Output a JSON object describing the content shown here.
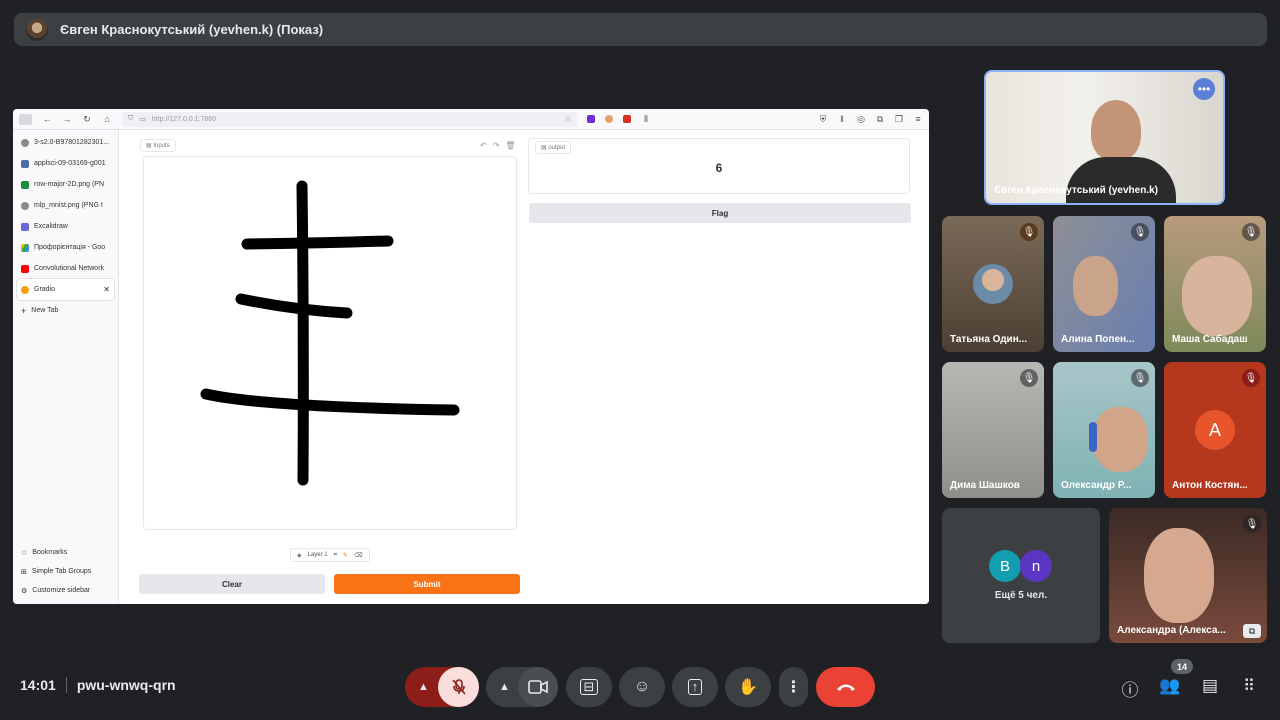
{
  "meeting": {
    "presenter_title": "Євген Краснокутський (yevhen.k) (Показ)",
    "time": "14:01",
    "code": "pwu-wnwq-qrn",
    "participants_count": "14"
  },
  "browser": {
    "url": "http://127.0.0.1:7860",
    "tabs": [
      {
        "label": "3-s2.0-B97801282301...",
        "icon": "globe-icon"
      },
      {
        "label": "applsci-09-03169-g001",
        "icon": "image-icon"
      },
      {
        "label": "row-major-2D.png (PN",
        "icon": "image-icon"
      },
      {
        "label": "mlp_mnist.png (PNG I",
        "icon": "globe-icon"
      },
      {
        "label": "Excalidraw",
        "icon": "excalidraw-icon"
      },
      {
        "label": "Профорієнтація - Goo",
        "icon": "drive-icon"
      },
      {
        "label": "Convolutional Network",
        "icon": "youtube-icon"
      },
      {
        "label": "Gradio",
        "icon": "gradio-icon",
        "active": true
      },
      {
        "label": "New Tab",
        "icon": "plus-icon"
      }
    ],
    "bottom_items": [
      {
        "label": "Bookmarks",
        "icon": "star-icon"
      },
      {
        "label": "Simple Tab Groups",
        "icon": "grid-icon"
      },
      {
        "label": "Customize sidebar",
        "icon": "gear-icon"
      }
    ]
  },
  "gradio": {
    "input_label": "Inputs",
    "output_label": "output",
    "output_value": "6",
    "layer_label": "Layer 1",
    "clear_label": "Clear",
    "submit_label": "Submit",
    "flag_label": "Flag"
  },
  "participants": [
    {
      "name": "Євген Краснокутський (yevhen.k)",
      "muted": false
    },
    {
      "name": "Татьяна Один...",
      "muted": true
    },
    {
      "name": "Алина Попен...",
      "muted": true
    },
    {
      "name": "Маша Сабадаш",
      "muted": true
    },
    {
      "name": "Дима Шашков",
      "muted": true
    },
    {
      "name": "Олександр Р...",
      "muted": true
    },
    {
      "name": "Антон Костян...",
      "muted": true,
      "avatar_letter": "A",
      "avatar_color": "#e8542b"
    },
    {
      "name": "Ещё 5 чел.",
      "avatars": [
        "B",
        "n"
      ],
      "avatar_colors": [
        "#129eaf",
        "#5b36c2"
      ]
    },
    {
      "name": "Александра (Алекса...",
      "muted": true
    }
  ],
  "colors": {
    "submit": "#f97316",
    "end_call": "#ea4335",
    "mic_off_bg": "#f9dedc",
    "raise_arrow_bg": "#8c1d18"
  }
}
